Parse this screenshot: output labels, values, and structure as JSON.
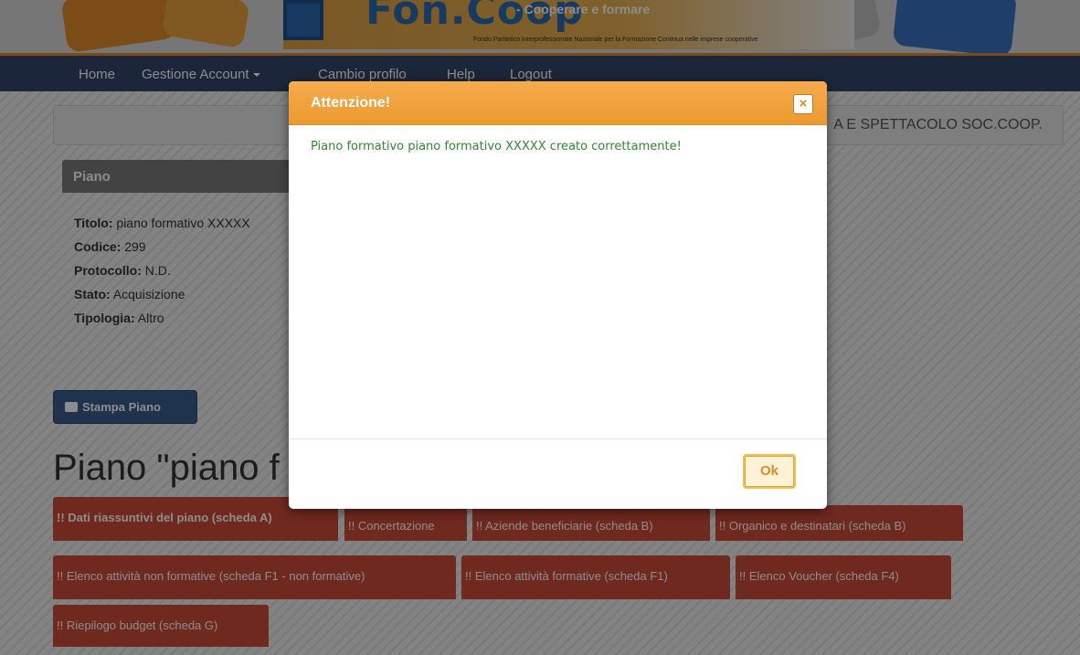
{
  "header": {
    "logo_title": "Fon.Coop",
    "logo_tagline": "- Cooperare e formare",
    "logo_subtitle": "Fondo Paritetico Interprofessionale Nazionale per la Formazione Continua nelle imprese cooperative"
  },
  "navbar": {
    "home": "Home",
    "gestione_account": "Gestione Account",
    "cambio_profilo": "Cambio profilo",
    "help": "Help",
    "logout": "Logout"
  },
  "infobar": {
    "organization": "A E SPETTACOLO SOC.COOP."
  },
  "piano": {
    "header": "Piano",
    "titolo_label": "Titolo:",
    "titolo_value": "piano formativo XXXXX",
    "codice_label": "Codice:",
    "codice_value": "299",
    "protocollo_label": "Protocollo:",
    "protocollo_value": "N.D.",
    "stato_label": "Stato:",
    "stato_value": "Acquisizione",
    "tipologia_label": "Tipologia:",
    "tipologia_value": "Altro"
  },
  "stampa_button": "Stampa Piano",
  "page_heading": "Piano \"piano f",
  "tabs": [
    "!! Dati riassuntivi del piano (scheda A)",
    "!! Concertazione",
    "!! Aziende beneficiarie (scheda B)",
    "!! Organico e destinatari (scheda B)",
    "!! Elenco attività non formative (scheda F1 - non formative)",
    "!! Elenco attività formative (scheda F1)",
    "!! Elenco Voucher (scheda F4)",
    "!! Riepilogo budget (scheda G)"
  ],
  "modal": {
    "title": "Attenzione!",
    "close_symbol": "×",
    "message": "Piano formativo piano formativo XXXXX creato correttamente!",
    "ok_label": "Ok"
  },
  "colors": {
    "navbar": "#34466b",
    "modal_header": "#f0a13c",
    "tab_red": "#cd4b3a",
    "success_text": "#2f8a2f"
  }
}
